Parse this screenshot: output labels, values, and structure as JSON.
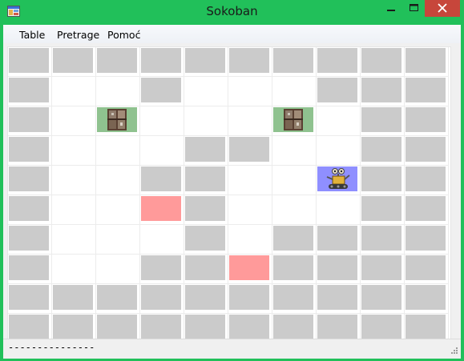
{
  "window": {
    "title": "Sokoban",
    "accent_color": "#21c05a",
    "close_color": "#c7463b"
  },
  "menu": {
    "items": [
      {
        "label": "Table"
      },
      {
        "label": "Pretrage"
      },
      {
        "label": "Pomoć"
      }
    ]
  },
  "board": {
    "rows": 10,
    "cols": 10,
    "legend": {
      "W": "wall",
      "B": "box",
      "T": "target",
      "P": "player",
      ".": "floor"
    },
    "grid": [
      "WWWWWWWWWW",
      "W..W...WWW",
      "W.B...B.WW",
      "W...WW..WW",
      "W..WW..PWW",
      "W..TW...WW",
      "W...W.WWWW",
      "W..WWTWWWW",
      "WWWWWWWWWW",
      "WWWWWWWWWW"
    ],
    "colors": {
      "wall": "#cbcbcb",
      "target": "#ff9a9a",
      "box_bg": "#8fc28f",
      "player_bg": "#8f8fff"
    },
    "icons": {
      "box": "crate-icon",
      "player": "robot-icon"
    }
  },
  "status": {
    "text": "---------------"
  }
}
